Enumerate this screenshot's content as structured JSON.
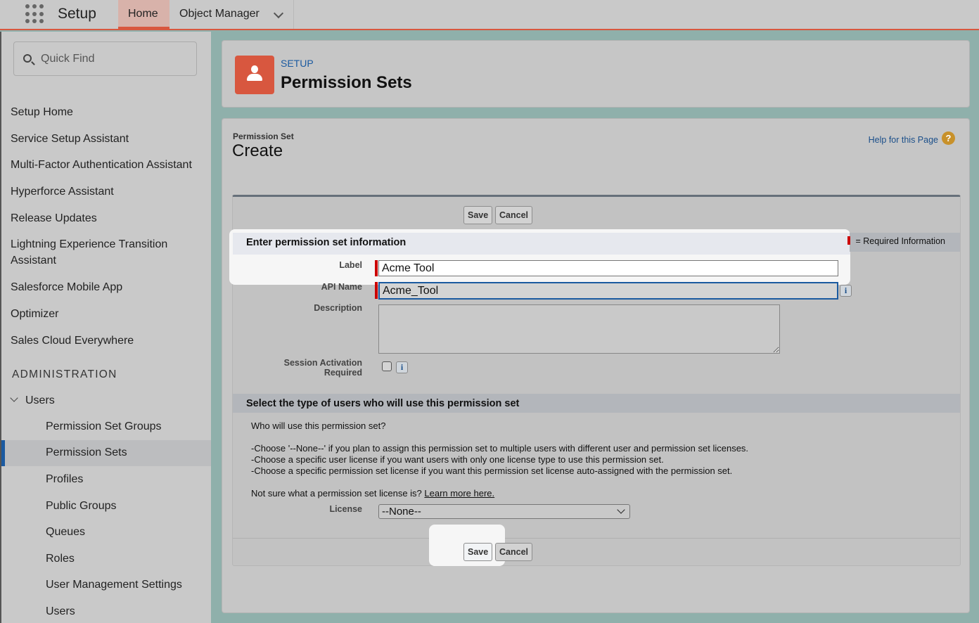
{
  "topbar": {
    "app_name": "Setup",
    "tabs": [
      {
        "label": "Home"
      },
      {
        "label": "Object Manager"
      }
    ]
  },
  "sidebar": {
    "search_placeholder": "Quick Find",
    "items": [
      {
        "label": "Setup Home"
      },
      {
        "label": "Service Setup Assistant"
      },
      {
        "label": "Multi-Factor Authentication Assistant"
      },
      {
        "label": "Hyperforce Assistant"
      },
      {
        "label": "Release Updates"
      },
      {
        "label": "Lightning Experience Transition Assistant"
      },
      {
        "label": "Salesforce Mobile App"
      },
      {
        "label": "Optimizer"
      },
      {
        "label": "Sales Cloud Everywhere"
      }
    ],
    "section_heading": "ADMINISTRATION",
    "group_label": "Users",
    "sub_items": [
      {
        "label": "Permission Set Groups"
      },
      {
        "label": "Permission Sets"
      },
      {
        "label": "Profiles"
      },
      {
        "label": "Public Groups"
      },
      {
        "label": "Queues"
      },
      {
        "label": "Roles"
      },
      {
        "label": "User Management Settings"
      },
      {
        "label": "Users"
      }
    ]
  },
  "header": {
    "eyebrow": "SETUP",
    "title": "Permission Sets"
  },
  "page": {
    "object_label": "Permission Set",
    "title": "Create",
    "help_link": "Help for this Page",
    "help_icon_glyph": "?"
  },
  "form": {
    "save_label": "Save",
    "cancel_label": "Cancel",
    "section1_title": "Enter permission set information",
    "required_legend": "= Required Information",
    "fields": {
      "label_label": "Label",
      "label_value": "Acme Tool",
      "api_name_label": "API Name",
      "api_name_value": "Acme_Tool",
      "description_label": "Description",
      "session_label_line1": "Session Activation",
      "session_label_line2": "Required",
      "info_glyph": "i"
    },
    "section2_title": "Select the type of users who will use this permission set",
    "question": "Who will use this permission set?",
    "bullets": [
      "-Choose '--None--' if you plan to assign this permission set to multiple users with different user and permission set licenses.",
      "-Choose a specific user license if you want users with only one license type to use this permission set.",
      "-Choose a specific permission set license if you want this permission set license auto-assigned with the permission set."
    ],
    "not_sure_text": "Not sure what a permission set license is?",
    "learn_more": "Learn more here.",
    "license_label": "License",
    "license_value": "--None--"
  }
}
